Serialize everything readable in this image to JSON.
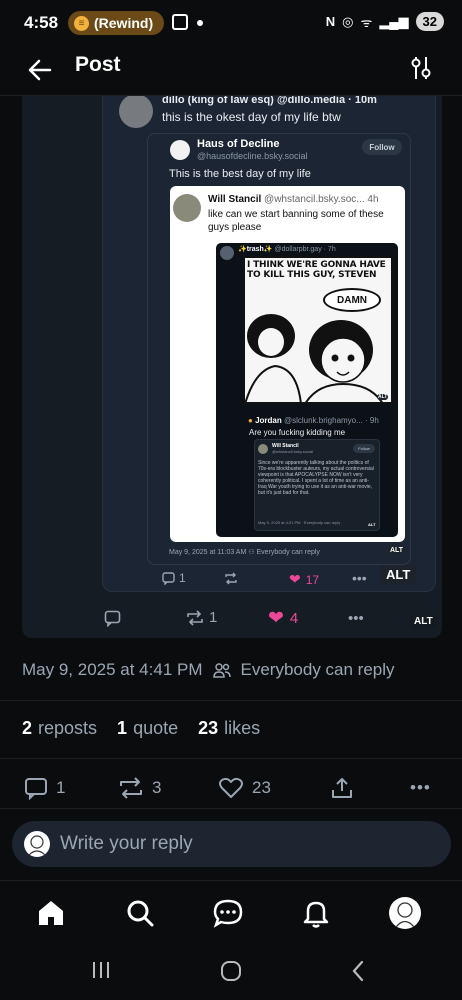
{
  "status_bar": {
    "time": "4:58",
    "rewind_label": "(Rewind)",
    "battery": "32"
  },
  "header": {
    "title": "Post"
  },
  "embed": {
    "outer_post": {
      "name_line": "dillo (king of law esq) @dillo.media · 10m",
      "text": "this is the okest day of my life btw"
    },
    "quote1": {
      "name": "Haus of Decline",
      "handle": "@hausofdecline.bsky.social",
      "follow": "Follow",
      "text": "This is the best day of my life",
      "timestamp": "May 9, 2025 at 11:03 AM",
      "reply_setting": "Everybody can reply",
      "alt": "ALT"
    },
    "quote2": {
      "name": "Will Stancil",
      "handle": "@whstancil.bsky.soc...",
      "age": "4h",
      "text": "like can we start banning some of these guys please"
    },
    "quote3": {
      "name": "✨trash✨",
      "handle": "@dollarpbr.gay · 7h",
      "comic_text1": "I THINK WE'RE GONNA HAVE TO KILL THIS GUY, STEVEN",
      "comic_text2": "DAMN",
      "alt": "ALT"
    },
    "quote4": {
      "name": "Jordan",
      "handle": "@slclunk.brighamyo... · 9h",
      "text": "Are you fucking kidding me",
      "inner_name": "Will Stancil",
      "inner_handle": "@whstancil.bsky.social",
      "inner_follow": "Follow",
      "inner_text": "Since we're apparently talking about the politics of 70s-era blockbuster auteurs, my actual controversial viewpoint is that APOCALYPSE NOW isn't very coherently political. I spent a lot of time as an anti-Iraq War youth trying to use it as an anti-war movie, but it's just bad for that.",
      "inner_date": "May 9, 2025 at 4:21 PM · Everybody can reply",
      "alt": "ALT"
    },
    "outer_actions": {
      "replies": "1",
      "likes": "17",
      "alt": "ALT"
    },
    "embed_actions": {
      "reposts": "1",
      "likes": "4",
      "alt": "ALT"
    }
  },
  "post_meta": {
    "date": "May 9, 2025 at 4:41 PM",
    "reply_setting": "Everybody can reply"
  },
  "stats": {
    "reposts_count": "2",
    "reposts_label": "reposts",
    "quotes_count": "1",
    "quotes_label": "quote",
    "likes_count": "23",
    "likes_label": "likes"
  },
  "actions": {
    "replies": "1",
    "reposts": "3",
    "likes": "23"
  },
  "reply_box": {
    "placeholder": "Write your reply"
  },
  "bottom_nav": [
    "home-icon",
    "search-icon",
    "chat-icon",
    "notifications-icon",
    "profile-avatar"
  ],
  "colors": {
    "background": "#0b0c0d",
    "like_pink": "#ec4899",
    "muted": "#9aa6b3",
    "rewind_badge": "#6b4a17"
  }
}
